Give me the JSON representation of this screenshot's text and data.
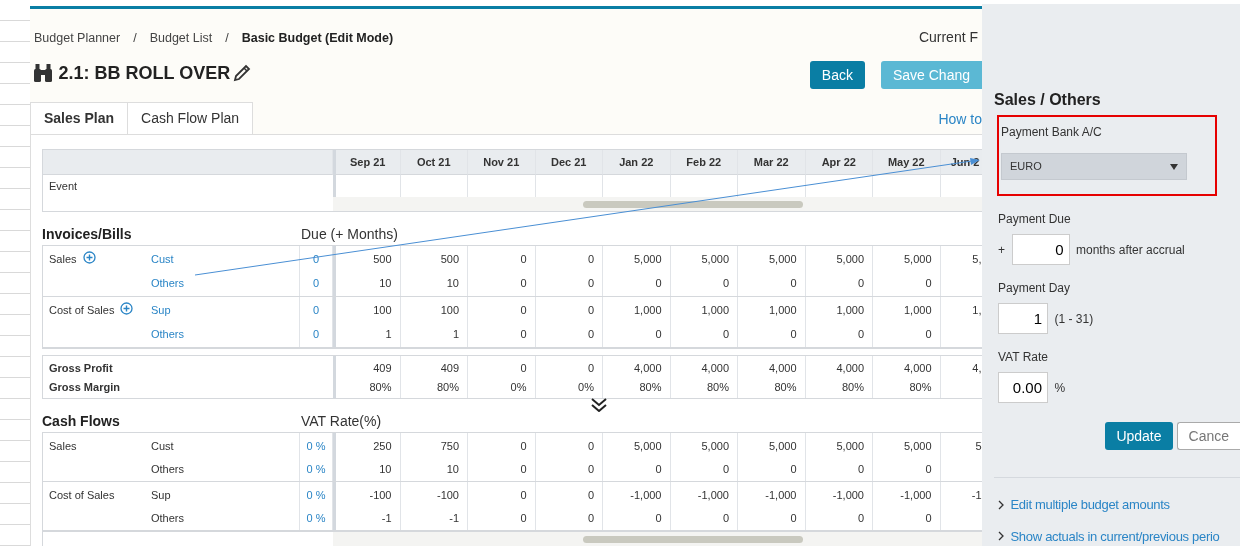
{
  "breadcrumb": {
    "separator": "/",
    "items": [
      {
        "label": "Budget Planner",
        "current": false
      },
      {
        "label": "Budget List",
        "current": false
      },
      {
        "label": "Basic Budget (Edit Mode)",
        "current": true
      }
    ]
  },
  "title": "2.1: BB ROLL OVER",
  "period_label": "Current F",
  "buttons": [
    {
      "label": "Back",
      "kind": "primary"
    },
    {
      "label": "Save Chang",
      "kind": "light"
    }
  ],
  "tabs": [
    {
      "label": "Sales Plan",
      "selected": true
    },
    {
      "label": "Cash Flow Plan",
      "selected": false
    }
  ],
  "help_link": "How to",
  "months": [
    "Sep 21",
    "Oct 21",
    "Nov 21",
    "Dec 21",
    "Jan 22",
    "Feb 22",
    "Mar 22",
    "Apr 22",
    "May 22",
    "Jun 2"
  ],
  "event_label": "Event",
  "invoices": {
    "title": "Invoices/Bills",
    "column_label": "Due (+ Months)",
    "linked": true,
    "groups": [
      {
        "label": "Sales",
        "expandable": true,
        "rows": [
          {
            "name": "Cust",
            "setting": "0",
            "values": [
              "500",
              "500",
              "0",
              "0",
              "5,000",
              "5,000",
              "5,000",
              "5,000",
              "5,000",
              "5,"
            ]
          },
          {
            "name": "Others",
            "setting": "0",
            "values": [
              "10",
              "10",
              "0",
              "0",
              "0",
              "0",
              "0",
              "0",
              "0"
            ]
          }
        ]
      },
      {
        "label": "Cost of Sales",
        "expandable": true,
        "rows": [
          {
            "name": "Sup",
            "setting": "0",
            "values": [
              "100",
              "100",
              "0",
              "0",
              "1,000",
              "1,000",
              "1,000",
              "1,000",
              "1,000",
              "1,"
            ]
          },
          {
            "name": "Others",
            "setting": "0",
            "values": [
              "1",
              "1",
              "0",
              "0",
              "0",
              "0",
              "0",
              "0",
              "0"
            ]
          }
        ]
      }
    ]
  },
  "gross": [
    {
      "label": "Gross Profit",
      "values": [
        "409",
        "409",
        "0",
        "0",
        "4,000",
        "4,000",
        "4,000",
        "4,000",
        "4,000",
        "4,"
      ]
    },
    {
      "label": "Gross Margin",
      "values": [
        "80%",
        "80%",
        "0%",
        "0%",
        "80%",
        "80%",
        "80%",
        "80%",
        "80%"
      ]
    }
  ],
  "cash_flows": {
    "title": "Cash Flows",
    "column_label": "VAT Rate(%)",
    "linked": false,
    "groups": [
      {
        "label": "Sales",
        "rows": [
          {
            "name": "Cust",
            "setting": "0 %",
            "values": [
              "250",
              "750",
              "0",
              "0",
              "5,000",
              "5,000",
              "5,000",
              "5,000",
              "5,000",
              "5"
            ]
          },
          {
            "name": "Others",
            "setting": "0 %",
            "values": [
              "10",
              "10",
              "0",
              "0",
              "0",
              "0",
              "0",
              "0",
              "0"
            ]
          }
        ]
      },
      {
        "label": "Cost of Sales",
        "rows": [
          {
            "name": "Sup",
            "setting": "0 %",
            "values": [
              "-100",
              "-100",
              "0",
              "0",
              "-1,000",
              "-1,000",
              "-1,000",
              "-1,000",
              "-1,000",
              "-1"
            ]
          },
          {
            "name": "Others",
            "setting": "0 %",
            "values": [
              "-1",
              "-1",
              "0",
              "0",
              "0",
              "0",
              "0",
              "0",
              "0"
            ]
          }
        ]
      }
    ]
  },
  "panel": {
    "title": "Sales / Others",
    "fields": [
      {
        "kind": "select",
        "label": "Payment Bank A/C",
        "value": "EURO",
        "highlighted": true
      },
      {
        "kind": "number",
        "label": "Payment Due",
        "prefix": "+",
        "value": "0",
        "suffix": "months after accrual",
        "highlighted": false
      },
      {
        "kind": "number",
        "label": "Payment Day",
        "value": "1",
        "suffix": "(1 - 31)",
        "highlighted": false
      },
      {
        "kind": "number",
        "label": "VAT Rate",
        "value": "0.00",
        "suffix": "%",
        "highlighted": false
      }
    ],
    "actions": [
      {
        "label": "Update",
        "kind": "primary"
      },
      {
        "label": "Cance",
        "kind": "secondary"
      }
    ],
    "links": [
      "Edit multiple budget amounts",
      "Show actuals in current/previous perio"
    ]
  }
}
